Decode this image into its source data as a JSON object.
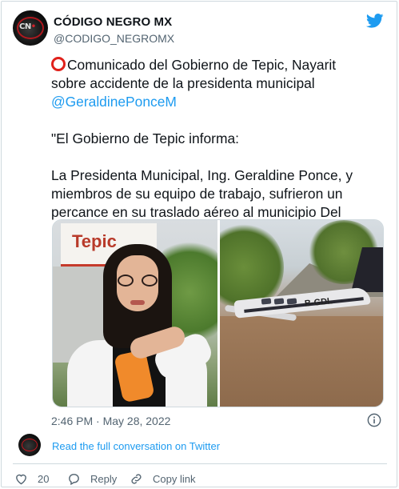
{
  "author": {
    "display_name": "CÓDIGO NEGRO MX",
    "handle": "@CODIGO_NEGROMX",
    "avatar_icon": "codigo-negro-logo"
  },
  "tweet": {
    "line1": "Comunicado del Gobierno de Tepic, Nayarit",
    "line2": "sobre accidente de la presidenta municipal",
    "mention": "@GeraldinePonceM",
    "line3": "\"El Gobierno de Tepic informa:",
    "line4": "La Presidenta Municipal, Ing. Geraldine Ponce, y",
    "line5": "miembros de su equipo de trabajo, sufrieron un",
    "line6": "percance en su traslado aéreo al municipio Del"
  },
  "media": {
    "left_sign_text": "Tepic",
    "right_plane_reg": "B-GDL"
  },
  "timestamp": "2:46 PM · May 28, 2022",
  "conversation_link": "Read the full conversation on Twitter",
  "actions": {
    "like_count": "20",
    "reply_label": "Reply",
    "copy_label": "Copy link"
  },
  "colors": {
    "accent": "#1d9bf0",
    "text": "#0f1419",
    "muted": "#536471",
    "border": "#cfd9de",
    "emoji_red": "#e0211b"
  }
}
